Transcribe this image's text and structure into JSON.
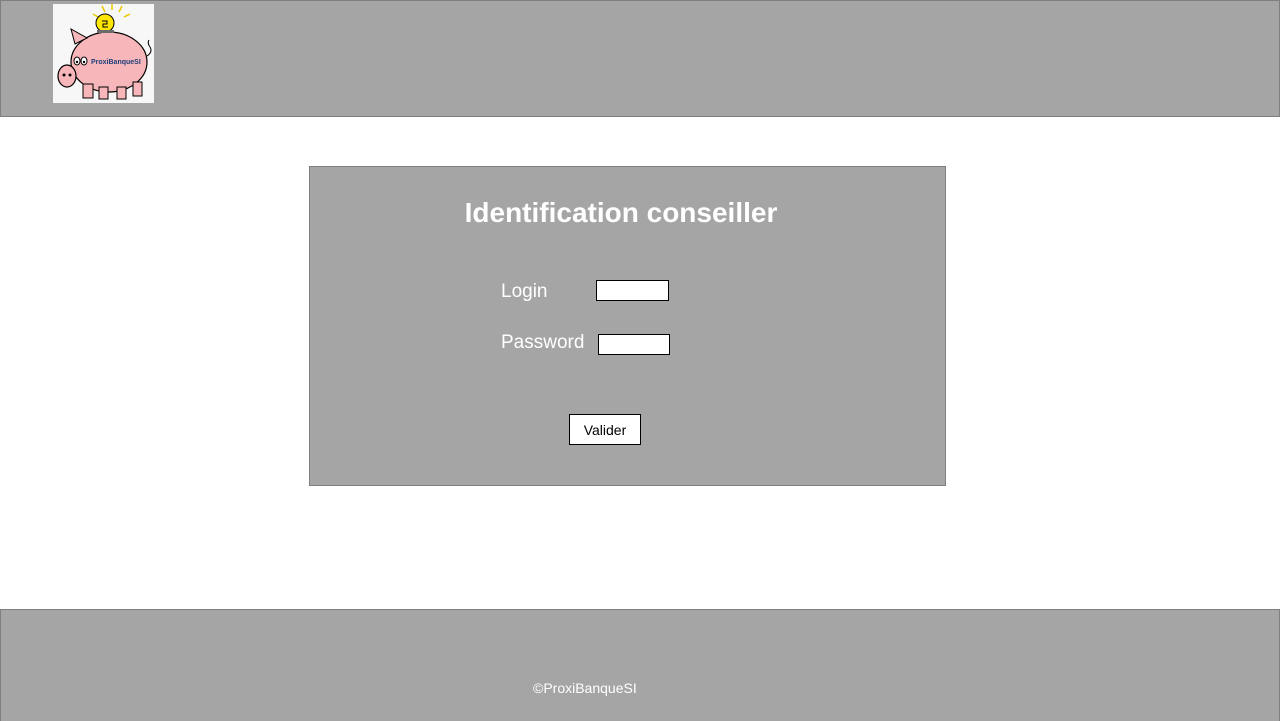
{
  "header": {
    "logo_text": "ProxiBanqueSI",
    "logo_icon": "piggy-bank-icon",
    "background": "#a5a5a5"
  },
  "login": {
    "title": "Identification conseiller",
    "login_label": "Login",
    "login_value": "",
    "password_label": "Password",
    "password_value": "",
    "submit_label": "Valider"
  },
  "footer": {
    "copyright": "©ProxiBanqueSI"
  },
  "colors": {
    "panel_gray": "#a5a5a5",
    "border_gray": "#7f7f7f",
    "text_white": "#ffffff",
    "pig_pink": "#f7b6b9",
    "coin_yellow": "#ffe600"
  }
}
